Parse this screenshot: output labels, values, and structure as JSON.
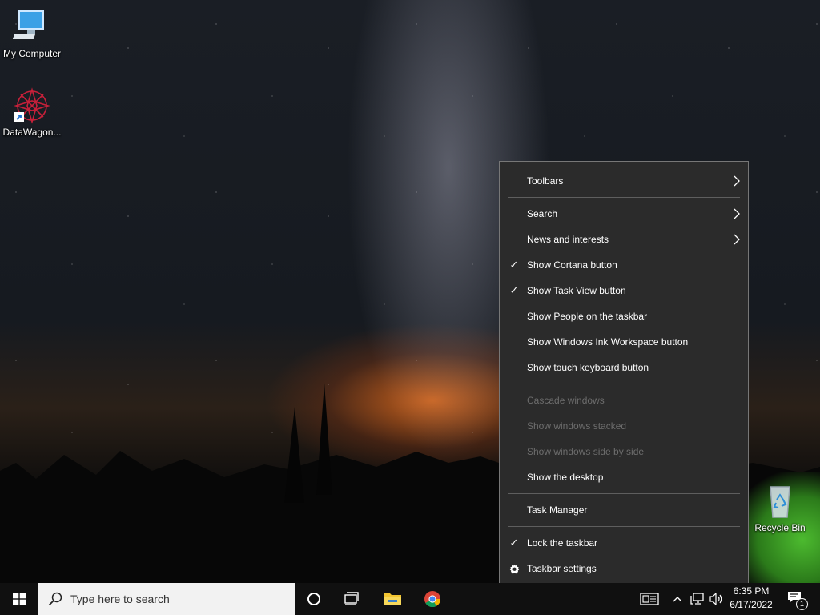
{
  "desktop": {
    "icons": [
      {
        "label": "My Computer",
        "icon": "computer-icon"
      },
      {
        "label": "DataWagon...",
        "icon": "datawagon-shortcut-icon"
      },
      {
        "label": "Recycle Bin",
        "icon": "recycle-bin-icon"
      }
    ]
  },
  "context_menu": {
    "items": [
      {
        "label": "Toolbars",
        "checked": false,
        "disabled": false,
        "submenu": true
      },
      {
        "label": "Search",
        "checked": false,
        "disabled": false,
        "submenu": true
      },
      {
        "label": "News and interests",
        "checked": false,
        "disabled": false,
        "submenu": true
      },
      {
        "label": "Show Cortana button",
        "checked": true,
        "disabled": false,
        "submenu": false
      },
      {
        "label": "Show Task View button",
        "checked": true,
        "disabled": false,
        "submenu": false
      },
      {
        "label": "Show People on the taskbar",
        "checked": false,
        "disabled": false,
        "submenu": false
      },
      {
        "label": "Show Windows Ink Workspace button",
        "checked": false,
        "disabled": false,
        "submenu": false
      },
      {
        "label": "Show touch keyboard button",
        "checked": false,
        "disabled": false,
        "submenu": false
      },
      {
        "label": "Cascade windows",
        "checked": false,
        "disabled": true,
        "submenu": false
      },
      {
        "label": "Show windows stacked",
        "checked": false,
        "disabled": true,
        "submenu": false
      },
      {
        "label": "Show windows side by side",
        "checked": false,
        "disabled": true,
        "submenu": false
      },
      {
        "label": "Show the desktop",
        "checked": false,
        "disabled": false,
        "submenu": false
      },
      {
        "label": "Task Manager",
        "checked": false,
        "disabled": false,
        "submenu": false
      },
      {
        "label": "Lock the taskbar",
        "checked": true,
        "disabled": false,
        "submenu": false
      },
      {
        "label": "Taskbar settings",
        "checked": false,
        "disabled": false,
        "submenu": false,
        "icon": "gear-icon"
      }
    ]
  },
  "taskbar": {
    "search_placeholder": "Type here to search",
    "time": "6:35 PM",
    "date": "6/17/2022",
    "notification_count": "1"
  },
  "colors": {
    "menu_bg": "#2b2b2b",
    "taskbar_bg": "#101010",
    "disabled_text": "#6d6d6d"
  }
}
